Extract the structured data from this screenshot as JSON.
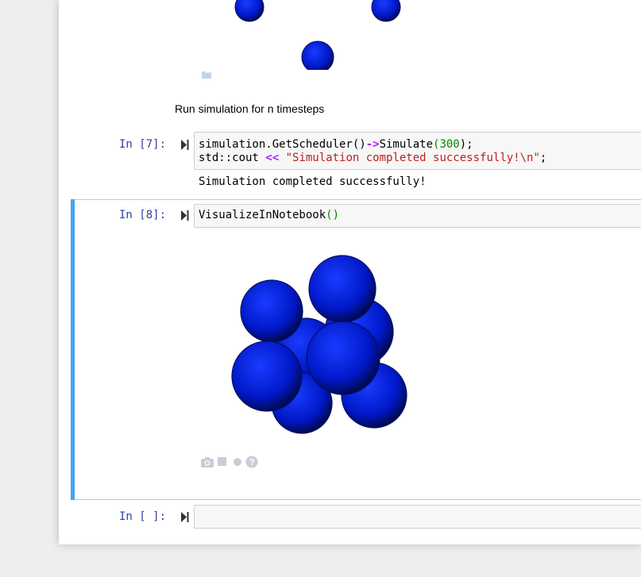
{
  "notebook": {
    "markdown_cell": {
      "text": "Run simulation for n timesteps"
    },
    "cell7": {
      "prompt": "In [7]:",
      "code_line1": {
        "obj": "simulation.GetScheduler()",
        "arrow": "->",
        "call": "Simulate",
        "open_paren": "(",
        "arg": "300",
        "close": ");"
      },
      "code_line2": {
        "obj": "std::cout ",
        "op": "<<",
        "space": " ",
        "str": "\"Simulation completed successfully!\\n\"",
        "end": ";"
      },
      "output": "Simulation completed successfully!"
    },
    "cell8": {
      "prompt": "In [8]:",
      "code_fn": "VisualizeInNotebook",
      "code_parens": "()"
    },
    "cell_empty": {
      "prompt": "In [ ]:"
    }
  },
  "colors": {
    "prompt": "#303f9f",
    "selection_bar": "#42a5f5",
    "sphere": "#0018c8",
    "toolbar_icon": "#c8ccd4"
  },
  "icons": [
    "run-cell-icon",
    "folder-icon",
    "camera-icon",
    "stop-icon",
    "record-icon",
    "help-icon"
  ]
}
